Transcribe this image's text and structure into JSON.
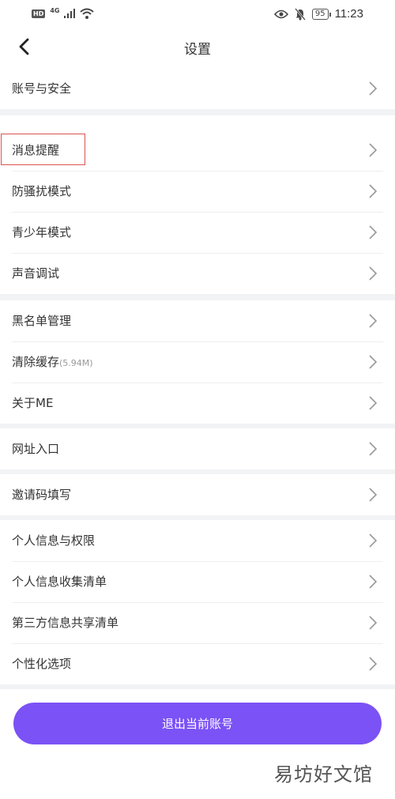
{
  "status_bar": {
    "hd": "HD",
    "network": "4G",
    "battery": "95",
    "time": "11:23"
  },
  "header": {
    "title": "设置"
  },
  "groups": [
    {
      "items": [
        {
          "label": "账号与安全"
        }
      ]
    },
    {
      "items": [
        {
          "label": "消息提醒"
        },
        {
          "label": "防骚扰模式"
        },
        {
          "label": "青少年模式"
        },
        {
          "label": "声音调试"
        }
      ]
    },
    {
      "items": [
        {
          "label": "黑名单管理"
        },
        {
          "label": "清除缓存",
          "hint": "(5.94M)"
        },
        {
          "label": "关于ME"
        }
      ]
    },
    {
      "items": [
        {
          "label": "网址入口"
        }
      ]
    },
    {
      "items": [
        {
          "label": "邀请码填写"
        }
      ]
    },
    {
      "items": [
        {
          "label": "个人信息与权限"
        },
        {
          "label": "个人信息收集清单"
        },
        {
          "label": "第三方信息共享清单"
        },
        {
          "label": "个性化选项"
        }
      ]
    }
  ],
  "logout_button": {
    "label": "退出当前账号"
  },
  "watermark": "易坊好文馆",
  "colors": {
    "accent": "#7b52f5",
    "highlight": "#d9534f",
    "divider": "#f2f3f5"
  }
}
